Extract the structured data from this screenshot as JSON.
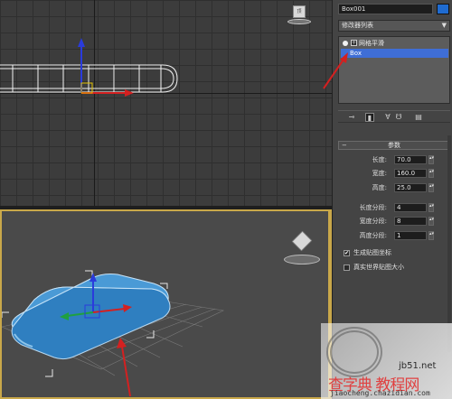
{
  "object": {
    "name": "Box001",
    "color": "#1f6bd0"
  },
  "modifier_list": {
    "label": "修改器列表"
  },
  "stack": {
    "modifier": "网格平滑",
    "base_object": "Box"
  },
  "viewport": {
    "top_cube_label": "顶",
    "highlight_color": "#c9a84a",
    "arrow_color": "#d42020"
  },
  "parameters": {
    "header": "参数",
    "fields": [
      {
        "label": "长度:",
        "value": "70.0"
      },
      {
        "label": "宽度:",
        "value": "160.0"
      },
      {
        "label": "高度:",
        "value": "25.0"
      },
      {
        "label": "长度分段:",
        "value": "4"
      },
      {
        "label": "宽度分段:",
        "value": "8"
      },
      {
        "label": "高度分段:",
        "value": "1"
      }
    ],
    "checks": [
      {
        "label": "生成贴图坐标",
        "checked": true,
        "mark": "✔"
      },
      {
        "label": "真实世界贴图大小",
        "checked": false,
        "mark": ""
      }
    ]
  },
  "watermark": {
    "brand": "查字典 教程网",
    "site": "jb51.net",
    "url": "jiaocheng.chazidian.com"
  }
}
